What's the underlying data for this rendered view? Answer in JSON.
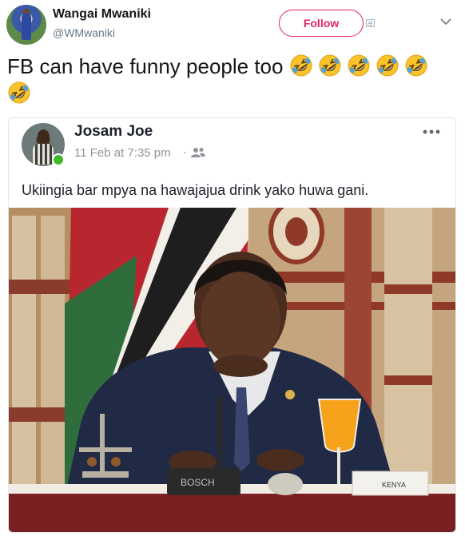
{
  "tweet": {
    "display_name": "Wangai Mwaniki",
    "handle": "@WMwaniki",
    "follow_label": "Follow",
    "text": "FB can have funny people too",
    "emoji": [
      "rolling-on-floor-laughing",
      "rolling-on-floor-laughing",
      "rolling-on-floor-laughing",
      "rolling-on-floor-laughing",
      "rolling-on-floor-laughing",
      "rolling-on-floor-laughing"
    ]
  },
  "fb_post": {
    "author": "Josam Joe",
    "timestamp": "11 Feb at 7:35 pm",
    "separator": "·",
    "audience_icon": "friends-icon",
    "more_icon": "ellipsis-icon",
    "text": "Ukiingia bar mpya na hawajajua drink yako huwa gani.",
    "photo": {
      "mic_label": "BOSCH",
      "placard_label": "KENYA"
    }
  },
  "colors": {
    "follow_accent": "#e0245e",
    "online": "#42b72a",
    "secondary_text": "#657786",
    "fb_meta": "#90949c"
  }
}
